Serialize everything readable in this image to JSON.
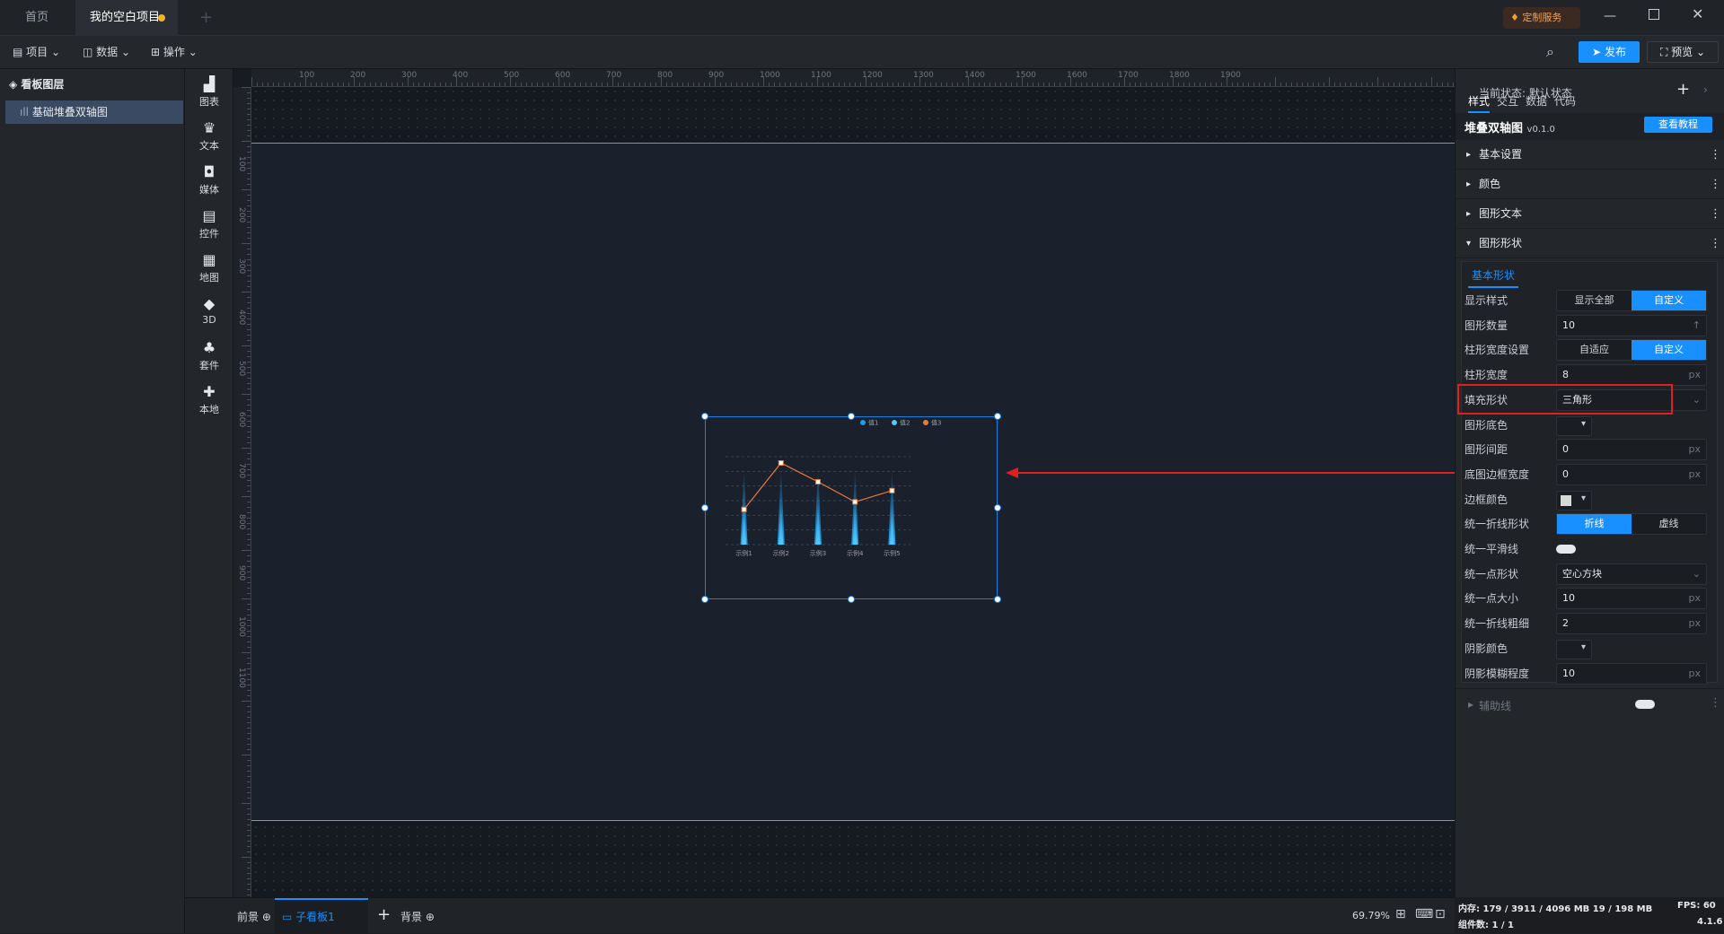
{
  "tabs": [
    {
      "label": "首页"
    },
    {
      "label": "我的空白项目"
    }
  ],
  "tabbar": {
    "service_label": "定制服务"
  },
  "toolbar": {
    "project": "项目",
    "data": "数据",
    "operate": "操作",
    "publish": "发布",
    "preview": "预览"
  },
  "layers": {
    "title": "看板图层",
    "items": [
      {
        "label": "基础堆叠双轴图"
      }
    ]
  },
  "rail": [
    {
      "label": "图表",
      "icon": "bar-chart-icon"
    },
    {
      "label": "文本",
      "icon": "text-icon"
    },
    {
      "label": "媒体",
      "icon": "media-icon"
    },
    {
      "label": "控件",
      "icon": "widget-icon"
    },
    {
      "label": "地图",
      "icon": "map-icon"
    },
    {
      "label": "3D",
      "icon": "cube-icon"
    },
    {
      "label": "套件",
      "icon": "suite-icon"
    },
    {
      "label": "本地",
      "icon": "puzzle-icon"
    }
  ],
  "ruler": {
    "top": [
      "100",
      "200",
      "300",
      "400",
      "500",
      "600",
      "700",
      "800",
      "900",
      "1000",
      "1100",
      "1200",
      "1300",
      "1400",
      "1500",
      "1600",
      "1700",
      "1800",
      "1900"
    ],
    "left": [
      "100",
      "200",
      "300",
      "400",
      "500",
      "600",
      "700",
      "800",
      "900",
      "1000",
      "1100"
    ]
  },
  "bottom": {
    "front": "前景",
    "child": "子看板1",
    "back": "背景",
    "zoom": "69.79%"
  },
  "chart_data": {
    "type": "bar",
    "categories": [
      "示例1",
      "示例2",
      "示例3",
      "示例4",
      "示例5"
    ],
    "series": [
      {
        "name": "值1",
        "kind": "bar",
        "values": [
          60,
          60,
          60,
          60,
          60
        ],
        "color": "#1f9cf0"
      },
      {
        "name": "值2",
        "kind": "bar",
        "values": [
          35,
          35,
          35,
          35,
          35
        ],
        "color": "#55c8f5"
      },
      {
        "name": "值3",
        "kind": "line",
        "values": [
          28,
          65,
          50,
          34,
          43
        ],
        "color": "#e87c3e"
      }
    ],
    "legend": "top-right",
    "grid": true
  },
  "rpanel": {
    "state_label": "当前状态:  默认状态",
    "tabs": [
      "样式",
      "交互",
      "数据",
      "代码"
    ],
    "component_name": "堆叠双轴图",
    "version": "v0.1.0",
    "tutorial": "查看教程",
    "sections": [
      "基本设置",
      "颜色",
      "图形文本",
      "图形形状"
    ],
    "subtab": "基本形状",
    "rows": [
      {
        "label": "显示样式",
        "kind": "seg",
        "options": [
          "显示全部",
          "自定义"
        ],
        "selected": 1
      },
      {
        "label": "图形数量",
        "kind": "input",
        "value": "10",
        "unit": "↑"
      },
      {
        "label": "柱形宽度设置",
        "kind": "seg",
        "options": [
          "自适应",
          "自定义"
        ],
        "selected": 1
      },
      {
        "label": "柱形宽度",
        "kind": "input",
        "value": "8",
        "unit": "px"
      },
      {
        "label": "填充形状",
        "kind": "select",
        "value": "三角形"
      },
      {
        "label": "图形底色",
        "kind": "color"
      },
      {
        "label": "图形间距",
        "kind": "input",
        "value": "0",
        "unit": "px"
      },
      {
        "label": "底图边框宽度",
        "kind": "input",
        "value": "0",
        "unit": "px"
      },
      {
        "label": "边框颜色",
        "kind": "color"
      },
      {
        "label": "统一折线形状",
        "kind": "seg",
        "options": [
          "折线",
          "虚线"
        ],
        "selected": 0
      },
      {
        "label": "统一平滑线",
        "kind": "toggle"
      },
      {
        "label": "统一点形状",
        "kind": "select",
        "value": "空心方块"
      },
      {
        "label": "统一点大小",
        "kind": "input",
        "value": "10",
        "unit": "px"
      },
      {
        "label": "统一折线粗细",
        "kind": "input",
        "value": "2",
        "unit": "px"
      },
      {
        "label": "阴影颜色",
        "kind": "color"
      },
      {
        "label": "阴影模糊程度",
        "kind": "input",
        "value": "10",
        "unit": "px"
      }
    ],
    "aux": "辅助线"
  },
  "status": {
    "memory_label": "内存:",
    "memory": "179 / 3911 / 4096 MB  19 / 198 MB",
    "fps": "FPS:  60",
    "count": "组件数: 1 / 1",
    "ver": "4.1.6"
  },
  "colors": {
    "accent": "#1890ff",
    "highlight": "#e02020"
  }
}
